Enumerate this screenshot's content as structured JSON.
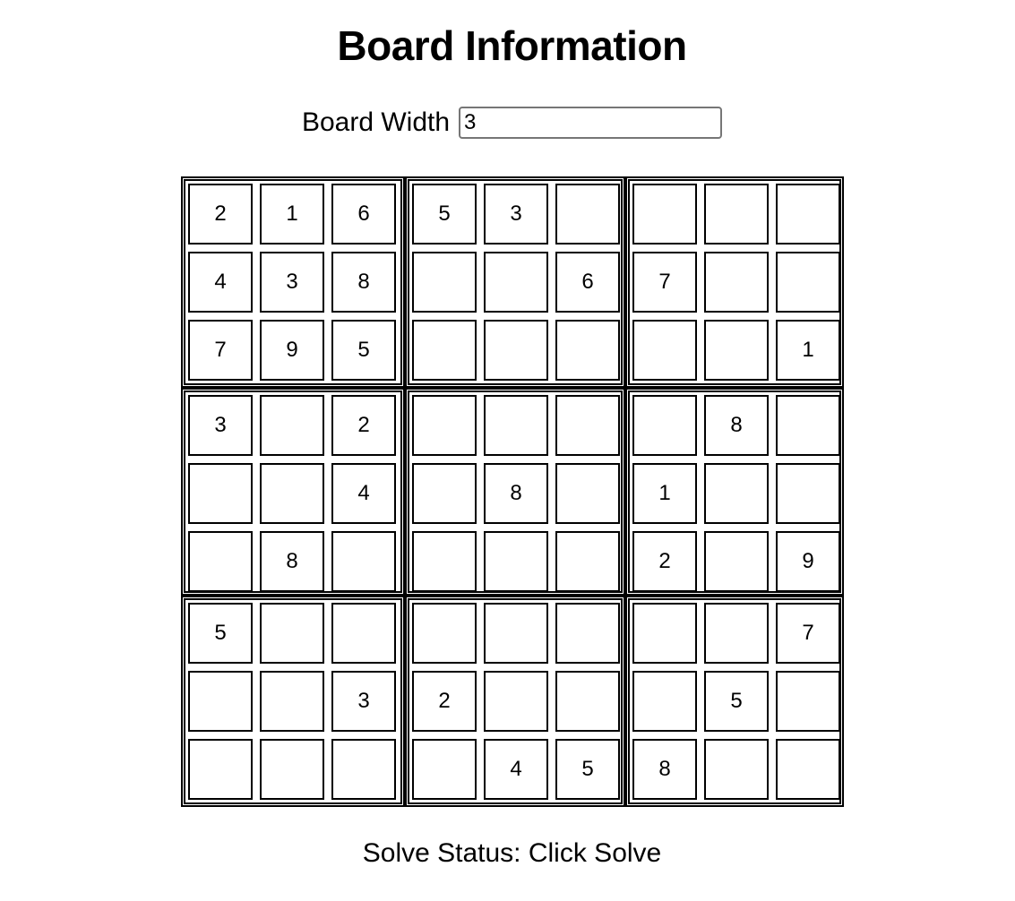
{
  "title": "Board Information",
  "board_width": {
    "label": "Board Width",
    "value": "3"
  },
  "board": {
    "size": 9,
    "cells": [
      [
        "2",
        "1",
        "6",
        "5",
        "3",
        "",
        "",
        "",
        ""
      ],
      [
        "4",
        "3",
        "8",
        "",
        "",
        "6",
        "7",
        "",
        ""
      ],
      [
        "7",
        "9",
        "5",
        "",
        "",
        "",
        "",
        "",
        "1"
      ],
      [
        "3",
        "",
        "2",
        "",
        "",
        "",
        "",
        "8",
        ""
      ],
      [
        "",
        "",
        "4",
        "",
        "8",
        "",
        "1",
        "",
        ""
      ],
      [
        "",
        "8",
        "",
        "",
        "",
        "",
        "2",
        "",
        "9"
      ],
      [
        "5",
        "",
        "",
        "",
        "",
        "",
        "",
        "",
        "7"
      ],
      [
        "",
        "",
        "3",
        "2",
        "",
        "",
        "",
        "5",
        ""
      ],
      [
        "",
        "",
        "",
        "",
        "4",
        "5",
        "8",
        "",
        ""
      ]
    ]
  },
  "status": {
    "text": "Solve Status: Click Solve"
  }
}
